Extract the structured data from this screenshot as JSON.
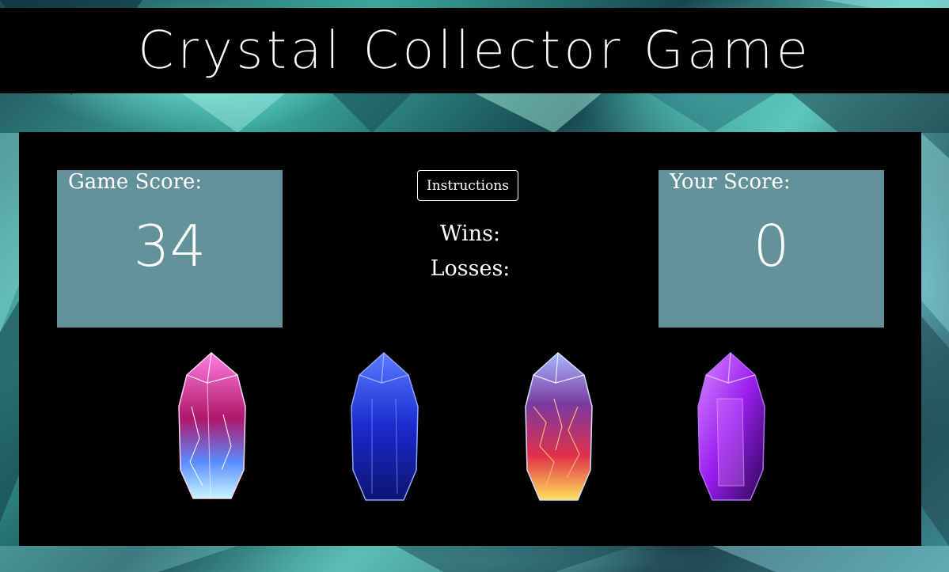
{
  "header": {
    "title": "Crystal Collector Game"
  },
  "game_score": {
    "label": "Game Score:",
    "value": "34"
  },
  "your_score": {
    "label": "Your Score:",
    "value": "0"
  },
  "controls": {
    "instructions_label": "Instructions"
  },
  "record": {
    "wins_label": "Wins:",
    "losses_label": "Losses:"
  },
  "crystals": [
    {
      "name": "pink-blue-crystal",
      "colors": [
        "#ff5fd2",
        "#c0186e",
        "#8fe8ff"
      ]
    },
    {
      "name": "blue-crystal",
      "colors": [
        "#4a6dff",
        "#1322b8",
        "#0a0f5c"
      ]
    },
    {
      "name": "fire-crystal",
      "colors": [
        "#9fb6ff",
        "#e0305a",
        "#ffd34a"
      ]
    },
    {
      "name": "purple-crystal",
      "colors": [
        "#c66bff",
        "#8a14e0",
        "#3a0868"
      ]
    }
  ],
  "colors": {
    "score_box": "#64929b",
    "panel": "#000000"
  }
}
